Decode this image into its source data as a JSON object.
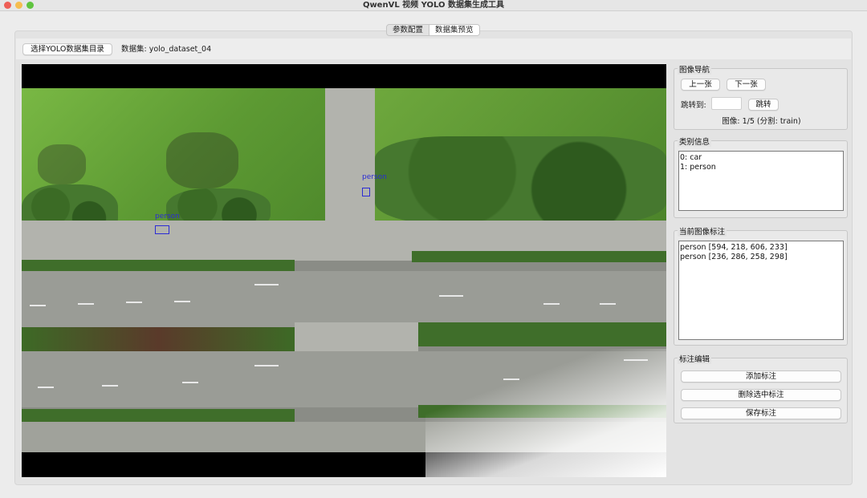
{
  "window": {
    "title": "QwenVL 视频 YOLO 数据集生成工具"
  },
  "tabs": [
    {
      "label": "参数配置",
      "active": false
    },
    {
      "label": "数据集预览",
      "active": true
    }
  ],
  "toolbar": {
    "select_dir_label": "选择YOLO数据集目录",
    "dataset_label": "数据集: yolo_dataset_04"
  },
  "viewer": {
    "detections": [
      {
        "label": "person"
      },
      {
        "label": "person"
      }
    ]
  },
  "navigation": {
    "title": "图像导航",
    "prev_label": "上一张",
    "next_label": "下一张",
    "jump_label": "跳转到:",
    "jump_value": "",
    "jump_button": "跳转",
    "status": "图像: 1/5 (分割: train)"
  },
  "classes": {
    "title": "类别信息",
    "items": [
      "0: car",
      "1: person"
    ]
  },
  "annotations": {
    "title": "当前图像标注",
    "items": [
      "person [594, 218, 606, 233]",
      "person [236, 286, 258, 298]"
    ]
  },
  "edit": {
    "title": "标注编辑",
    "add_label": "添加标注",
    "delete_label": "删除选中标注",
    "save_label": "保存标注"
  },
  "colors": {
    "bbox": "#2b2bd4",
    "accent_close": "#ee5e56",
    "accent_minimize": "#f5bd4f",
    "accent_maximize": "#5fc43f"
  }
}
